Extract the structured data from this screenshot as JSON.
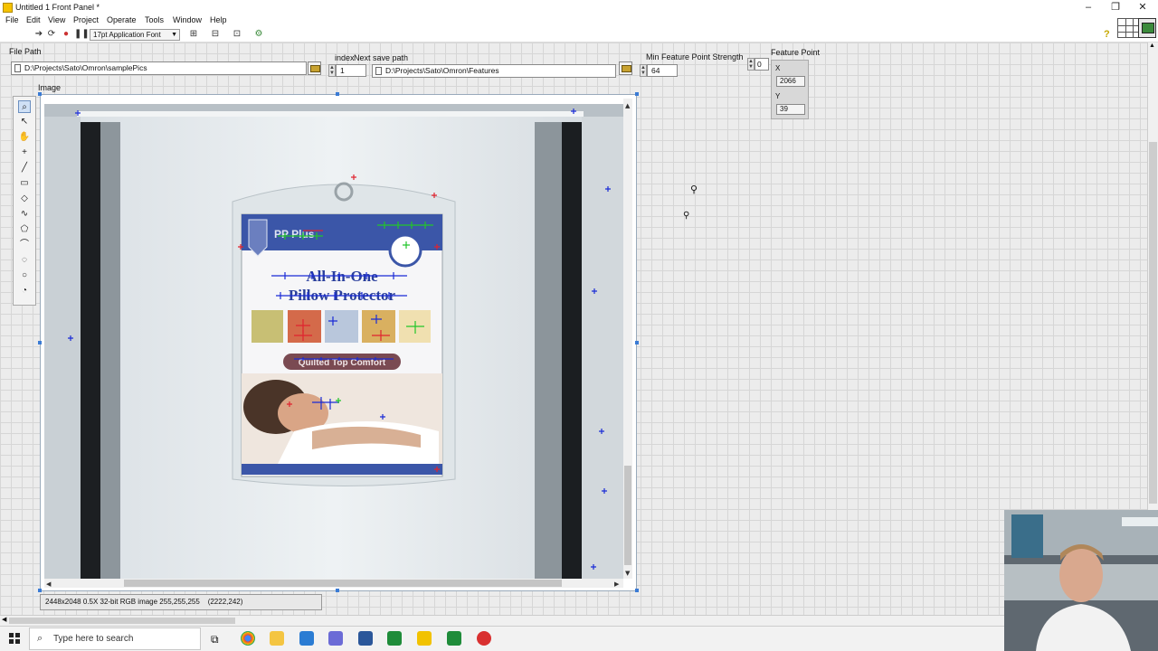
{
  "window": {
    "title": "Untitled 1 Front Panel *",
    "minimize": "–",
    "restore": "❐",
    "close": "✕"
  },
  "menu": [
    "File",
    "Edit",
    "View",
    "Project",
    "Operate",
    "Tools",
    "Window",
    "Help"
  ],
  "toolbar": {
    "font": "17pt Application Font",
    "help": "?"
  },
  "file_path": {
    "label": "File Path",
    "value": "D:\\Projects\\Sato\\Omron\\samplePics"
  },
  "index": {
    "label": "index",
    "value": "1"
  },
  "next_save_path": {
    "label": "Next save path",
    "value": "D:\\Projects\\Sato\\Omron\\Features"
  },
  "min_strength": {
    "label": "Min Feature Point Strength",
    "value": "64",
    "index_value": "0"
  },
  "feature_point": {
    "label": "Feature Point",
    "x_label": "X",
    "x_value": "2066",
    "y_label": "Y",
    "y_value": "39"
  },
  "image": {
    "label": "Image",
    "status_text": "2448x2048 0.5X 32-bit RGB image 255,255,255",
    "status_coords": "(2222,242)"
  },
  "package": {
    "brand": "PP Plus",
    "headline_1": "All-In-One",
    "headline_2": "Pillow Protector",
    "banner": "Quilted Top Comfort"
  },
  "taskbar": {
    "search_placeholder": "Type here to search"
  },
  "colors": {
    "panel_bg": "#ececec",
    "accent": "#3a7bd5",
    "package_blue": "#3b56a8"
  }
}
